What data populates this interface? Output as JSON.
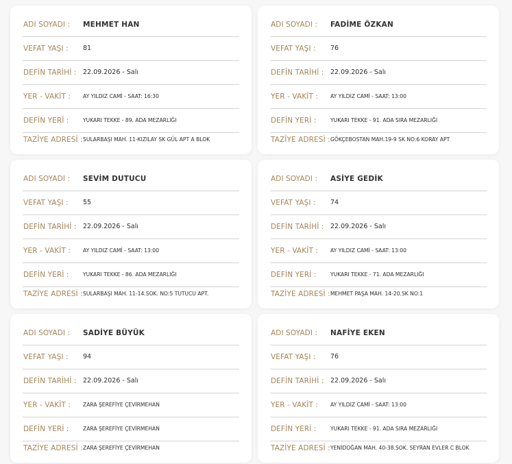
{
  "labels": {
    "name": "ADI SOYADI :",
    "age": "VEFAT YAŞI :",
    "date": "DEFİN TARİHİ :",
    "place_time": "YER - VAKİT :",
    "burial": "DEFİN YERİ :",
    "condolence": "TAZİYE ADRESİ :"
  },
  "cards": [
    {
      "name": "MEHMET HAN",
      "age": "81",
      "date": "22.09.2026 - Salı",
      "place_time": "AY YILDIZ CAMİ - SAAT: 16:30",
      "burial": "YUKARI TEKKE - 89. ADA MEZARLIĞI",
      "condolence": "SULARBAŞI MAH. 11-KIZILAY SK GÜL APT A BLOK"
    },
    {
      "name": "FADİME ÖZKAN",
      "age": "76",
      "date": "22.09.2026 - Salı",
      "place_time": "AY YILDIZ CAMİ - SAAT: 13:00",
      "burial": "YUKARI TEKKE - 91. ADA SIRA MEZARLIĞI",
      "condolence": "GÖKÇEBOSTAN MAH.19-9 SK NO:6 KORAY APT"
    },
    {
      "name": "SEVİM DUTUCU",
      "age": "55",
      "date": "22.09.2026 - Salı",
      "place_time": "AY YILDIZ CAMİ - SAAT: 13:00",
      "burial": "YUKARI TEKKE - 86. ADA MEZARLIĞI",
      "condolence": "SULARBAŞI MAH. 11-14.SOK. NO:5 TUTUCU APT."
    },
    {
      "name": "ASİYE GEDİK",
      "age": "74",
      "date": "22.09.2026 - Salı",
      "place_time": "AY YILDIZ CAMİ - SAAT: 13:00",
      "burial": "YUKARI TEKKE - 71. ADA MEZARLIĞI",
      "condolence": "MEHMET PAŞA MAH. 14-20.SK NO:1"
    },
    {
      "name": "SADİYE BÜYÜK",
      "age": "94",
      "date": "22.09.2026 - Salı",
      "place_time": "ZARA ŞEREFİYE ÇEVİRMEHAN",
      "burial": "ZARA ŞEREFİYE ÇEVİRMEHAN",
      "condolence": "ZARA ŞEREFİYE ÇEVİRMEHAN"
    },
    {
      "name": "NAFİYE EKEN",
      "age": "76",
      "date": "22.09.2026 - Salı",
      "place_time": "AY YILDIZ CAMİ - SAAT: 13:00",
      "burial": "YUKARI TEKKE - 91. ADA SIRA MEZARLIĞI",
      "condolence": "YENİDOĞAN MAH. 40-38.SOK. SEYRAN EVLER C BLOK"
    }
  ]
}
